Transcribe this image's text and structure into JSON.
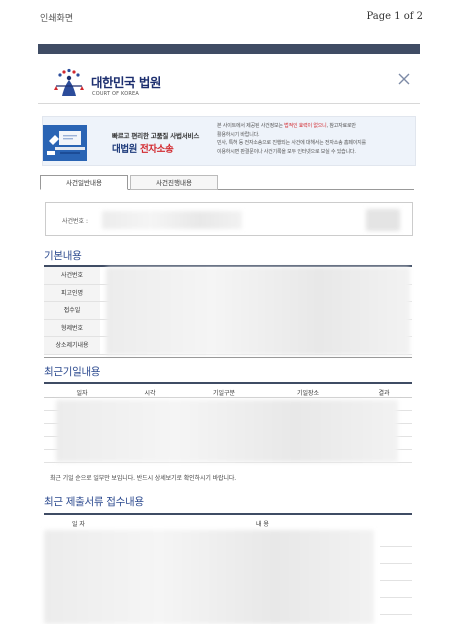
{
  "print_header": {
    "left": "인쇄화면",
    "right": "Page 1 of 2"
  },
  "court": {
    "title": "대한민국 법원",
    "subtitle": "COURT OF KOREA"
  },
  "banner": {
    "line1": "빠르고 편리한 고품질 사법서비스",
    "line2_main": "대법원 ",
    "line2_accent": "전자소송",
    "right_l1_a": "본 사이트에서 제공된 사건정보는 ",
    "right_l1_hl": "법적인 효력이 없으니",
    "right_l1_b": ", 참고자료로만",
    "right_l2": "활용하시기 바랍니다.",
    "right_l3": "민사, 특허 등 전자소송으로 진행되는 사건에 대해서는 전자소송 홈페이지를",
    "right_l4": "이용하시면 판결문이나 사건기록을 모두 인터넷으로 보실 수 있습니다."
  },
  "tabs": [
    {
      "label": "사건일반내용",
      "active": true
    },
    {
      "label": "사건진행내용",
      "active": false
    }
  ],
  "case_number_label": "사건번호 :",
  "basic": {
    "title": "기본내용",
    "rows": [
      "사건번호",
      "피고인명",
      "접수일",
      "형제번호",
      "상소제기내용"
    ]
  },
  "recent": {
    "title": "최근기일내용",
    "columns": [
      "일자",
      "시각",
      "기일구분",
      "기일장소",
      "결과"
    ],
    "notice": "최근 기일 순으로 일부만 보입니다. 반드시 상세보기로 확인하시기 바랍니다."
  },
  "documents": {
    "title": "최근 제출서류 접수내용",
    "columns": [
      "일 자",
      "내 용"
    ]
  },
  "colors": {
    "navy": "#3f4c64",
    "title_blue": "#2c4a8f",
    "accent_red": "#d2282e"
  }
}
